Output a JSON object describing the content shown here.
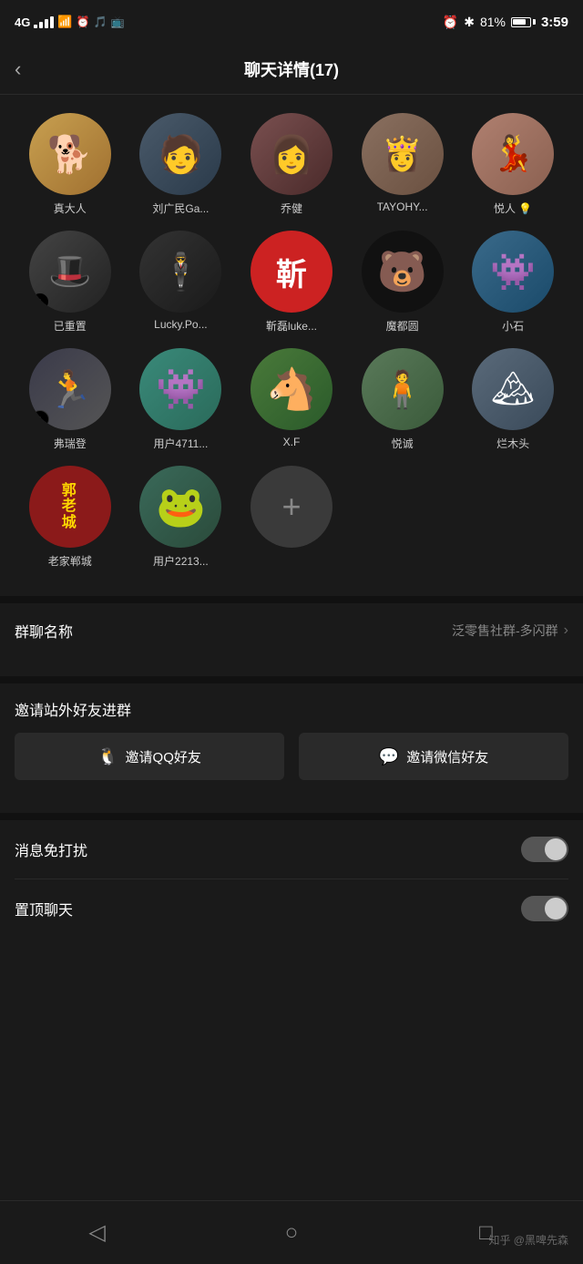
{
  "statusBar": {
    "carrier": "4G",
    "time": "3:59",
    "battery": "81%",
    "icons": [
      "alarm",
      "bluetooth",
      "battery"
    ]
  },
  "header": {
    "title": "聊天详情(17)",
    "backLabel": "‹"
  },
  "members": [
    {
      "id": 1,
      "name": "真大人",
      "avatarType": "dog",
      "hasTiktok": false
    },
    {
      "id": 2,
      "name": "刘广民Ga...",
      "avatarType": "man1",
      "hasTiktok": false
    },
    {
      "id": 3,
      "name": "乔健",
      "avatarType": "girl1",
      "hasTiktok": false
    },
    {
      "id": 4,
      "name": "TAYOHY...",
      "avatarType": "girl2",
      "hasTiktok": false
    },
    {
      "id": 5,
      "name": "悦人 💡",
      "avatarType": "girl3",
      "hasTiktok": false
    },
    {
      "id": 6,
      "name": "已重置",
      "avatarType": "hat",
      "hasTiktok": true
    },
    {
      "id": 7,
      "name": "Lucky.Po...",
      "avatarType": "black",
      "hasTiktok": false
    },
    {
      "id": 8,
      "name": "靳磊luke...",
      "avatarType": "red",
      "hasTiktok": false
    },
    {
      "id": 9,
      "name": "魔都圆",
      "avatarType": "bear",
      "hasTiktok": false
    },
    {
      "id": 10,
      "name": "小石",
      "avatarType": "blue",
      "hasTiktok": false
    },
    {
      "id": 11,
      "name": "弗瑞登",
      "avatarType": "runner",
      "hasTiktok": true
    },
    {
      "id": 12,
      "name": "用户4711...",
      "avatarType": "monster",
      "hasTiktok": false
    },
    {
      "id": 13,
      "name": "X.F",
      "avatarType": "horse",
      "hasTiktok": false
    },
    {
      "id": 14,
      "name": "悦诚",
      "avatarType": "person",
      "hasTiktok": false
    },
    {
      "id": 15,
      "name": "烂木头",
      "avatarType": "outdoor",
      "hasTiktok": false
    },
    {
      "id": 16,
      "name": "老家郸城",
      "avatarType": "laojia",
      "hasTiktok": false
    },
    {
      "id": 17,
      "name": "用户2213...",
      "avatarType": "frog",
      "hasTiktok": false
    }
  ],
  "settings": {
    "groupNameLabel": "群聊名称",
    "groupNameValue": "泛零售社群-多闪群",
    "inviteLabel": "邀请站外好友进群",
    "inviteQQ": "邀请QQ好友",
    "inviteWeChat": "邀请微信好友",
    "muteLabel": "消息免打扰",
    "pinLabel": "置顶聊天"
  },
  "bottomNav": {
    "backIcon": "◁",
    "homeIcon": "○",
    "recentIcon": "□",
    "credit": "知乎 @黑啤先森"
  }
}
